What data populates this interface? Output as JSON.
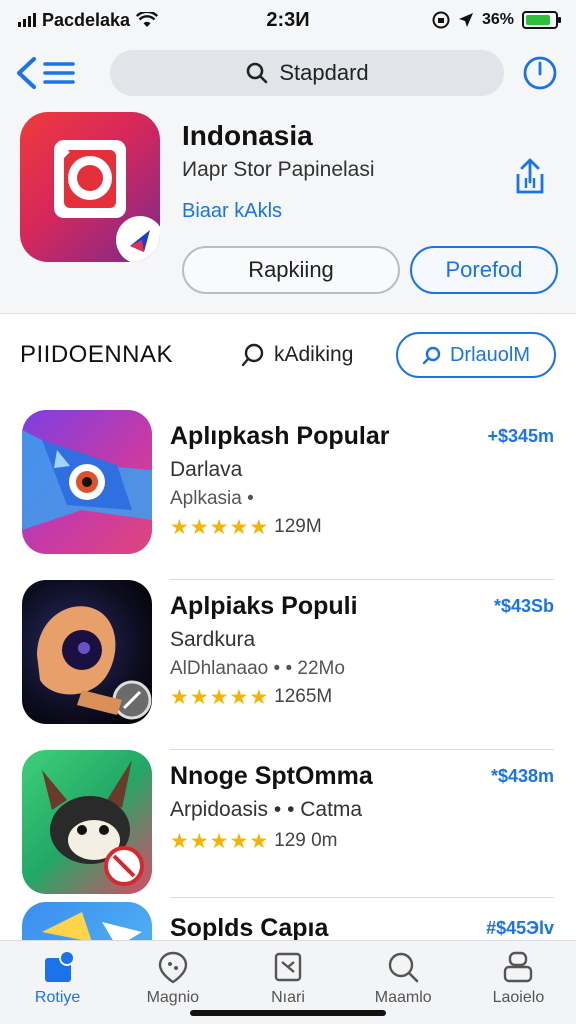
{
  "status_bar": {
    "carrier": "Pacdelaka",
    "time": "2:3И",
    "battery_percent": "36%",
    "battery_level": 0.85,
    "colors": {
      "battery": "#2fbf3a"
    }
  },
  "nav": {
    "back_icon": "chevron-left-icon",
    "menu_icon": "menu-icon",
    "search_placeholder": "Stapdard",
    "power_icon": "power-icon"
  },
  "app_header": {
    "title": "Indonasia",
    "subtitle": "Иapr Stor Papinelasi",
    "link": "Biaar kAkls",
    "button_secondary": "Rapkiing",
    "button_primary": "Porefod",
    "share_icon": "share-icon"
  },
  "section": {
    "title": "PIIDOENNAK",
    "sort_label": "kAdiking",
    "button_label": "DrlauolM"
  },
  "apps": [
    {
      "name": "Aplıpkash Popular",
      "subtitle": "Darlava",
      "meta": "Aplkasia •",
      "rating": 4.5,
      "count": "129M",
      "price": "+$345m"
    },
    {
      "name": "Aplpiaks Populi",
      "subtitle": "Sardkura",
      "meta": "AlDhlanaao • • 22Mo",
      "rating": 4.5,
      "count": "1265M",
      "price": "*$43Sb"
    },
    {
      "name": "Nnoge SptOmma",
      "subtitle": "Arpidoasis • • Catma",
      "meta": "",
      "rating": 4.5,
      "count": "129 0m",
      "price": "*$438m"
    },
    {
      "name": "Soplds Capıa",
      "subtitle": "",
      "meta": "",
      "rating": 0,
      "count": "",
      "price": "#$45Эlv"
    }
  ],
  "tabs": [
    {
      "label": "Rotiye",
      "icon": "home-icon",
      "active": true
    },
    {
      "label": "Magnio",
      "icon": "map-pin-icon",
      "active": false
    },
    {
      "label": "Nıari",
      "icon": "tools-icon",
      "active": false
    },
    {
      "label": "Maamlo",
      "icon": "search-icon",
      "active": false
    },
    {
      "label": "Laoielo",
      "icon": "profile-icon",
      "active": false
    }
  ],
  "colors": {
    "accent": "#1a73e8",
    "star": "#f4b400"
  }
}
